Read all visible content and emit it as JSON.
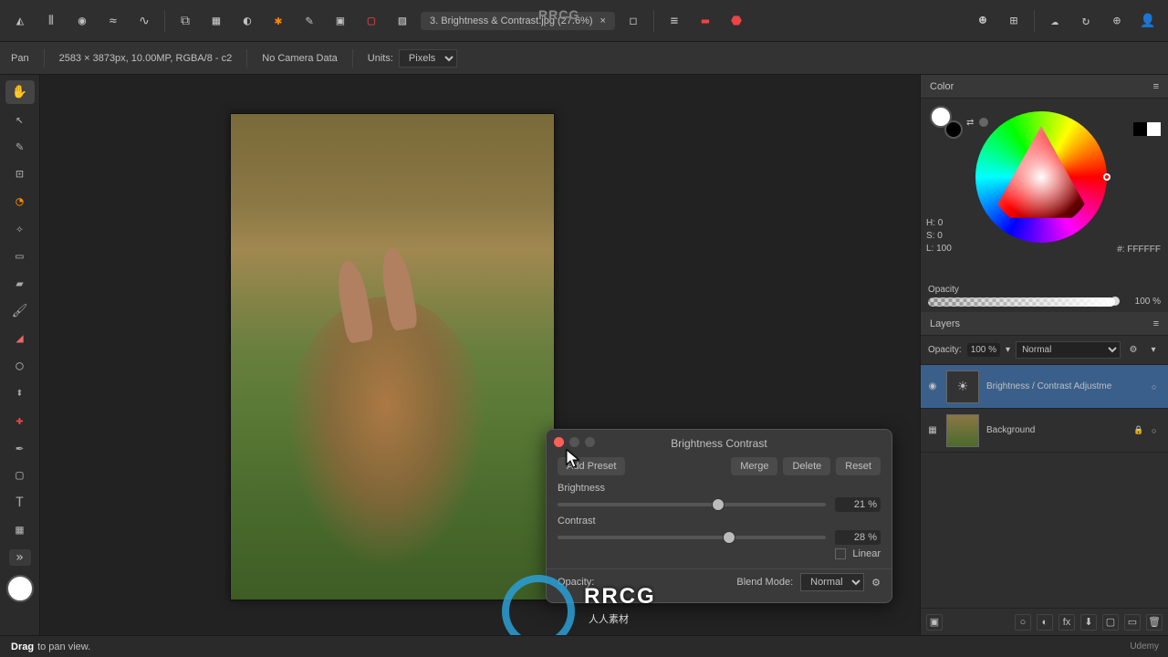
{
  "brand_watermark": {
    "text": "RRCG",
    "sub": "人人素材"
  },
  "document": {
    "tab_label": "3. Brightness & Contrast.jpg (27.6%)"
  },
  "context": {
    "tool": "Pan",
    "dimensions": "2583 × 3873px, 10.00MP, RGBA/8 - c2",
    "camera": "No Camera Data",
    "units_label": "Units:",
    "units_value": "Pixels"
  },
  "color_panel": {
    "title": "Color",
    "hsl": {
      "h": "H: 0",
      "s": "S: 0",
      "l": "L: 100"
    },
    "hex_prefix": "#:",
    "hex": "FFFFFF",
    "opacity_label": "Opacity",
    "opacity_value": "100 %"
  },
  "layers_panel": {
    "title": "Layers",
    "opacity_label": "Opacity:",
    "opacity_value": "100 %",
    "blend_mode": "Normal",
    "layers": [
      {
        "name": "Brightness / Contrast Adjustme",
        "type": "adjustment",
        "visible": true
      },
      {
        "name": "Background",
        "type": "pixel",
        "visible": true,
        "locked": true
      }
    ]
  },
  "dialog": {
    "title": "Brightness Contrast",
    "add_preset": "Add Preset",
    "merge": "Merge",
    "delete": "Delete",
    "reset": "Reset",
    "brightness_label": "Brightness",
    "brightness_value": "21 %",
    "brightness_percent": 60,
    "contrast_label": "Contrast",
    "contrast_value": "28 %",
    "contrast_percent": 64,
    "linear_label": "Linear",
    "opacity_label": "Opacity:",
    "blend_label": "Blend Mode:",
    "blend_value": "Normal"
  },
  "status": {
    "hint_strong": "Drag",
    "hint_rest": "to pan view."
  },
  "udemy": "Udemy"
}
